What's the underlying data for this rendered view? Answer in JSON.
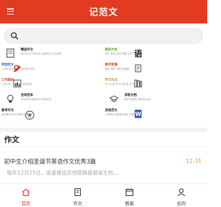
{
  "header": {
    "title": "记范文"
  },
  "search": {
    "placeholder": ""
  },
  "categories": [
    {
      "label": "精选作文",
      "desc": "满分作文 中考作文 优秀作文 作文素材"
    },
    {
      "label": "知识大全",
      "desc": "语文 数学 英语 物理 化学 生物"
    },
    {
      "label": "党团范文",
      "desc": "入党申请书 思想汇报 转正申请"
    },
    {
      "label": "教学资源",
      "desc": "教案 课件 试题 说课稿"
    },
    {
      "label": "工作规划",
      "desc": "工作计划 工作总结 述职报告"
    },
    {
      "label": "学习方法",
      "desc": "学习计划 学习心得 复习方法"
    },
    {
      "label": "合同范本",
      "desc": "劳动合同 租房合同 购房合同"
    },
    {
      "label": "求职文档",
      "desc": "简历 自荐信 求职信 面试"
    },
    {
      "label": "高考作文",
      "desc": "高考满分作文 高考作文题目"
    },
    {
      "label": "其他范文",
      "desc": "心得体会 演讲稿 致辞 祝福语"
    }
  ],
  "colors": {
    "brand": "#e23b1f",
    "date": "#e79a1e",
    "category_labels": [
      "#222222",
      "#4a8a1e",
      "#2f66c8",
      "#e23b1f",
      "#e23b1f",
      "#e77c1e",
      "#222222",
      "#222222",
      "#222222",
      "#222222"
    ]
  },
  "icons": [
    "notebook-icon",
    "chinese-char-icon",
    "party-emblem-icon",
    "book-icon",
    "chart-icon",
    "book-stack-icon",
    "bulb-icon",
    "cap-icon",
    "exam-icon",
    "word-doc-icon"
  ],
  "section": {
    "title": "作文"
  },
  "article": {
    "title": "初中生介绍圣诞节英语作文优秀3篇",
    "date": "12-31",
    "summary": "每年12月25日，是基督徒庆祝耶稣基督诞生的..."
  },
  "tabs": [
    {
      "label": "首页",
      "icon": "home-icon"
    },
    {
      "label": "作文",
      "icon": "document-icon"
    },
    {
      "label": "教案",
      "icon": "calendar-icon"
    },
    {
      "label": "合同",
      "icon": "user-icon"
    }
  ]
}
